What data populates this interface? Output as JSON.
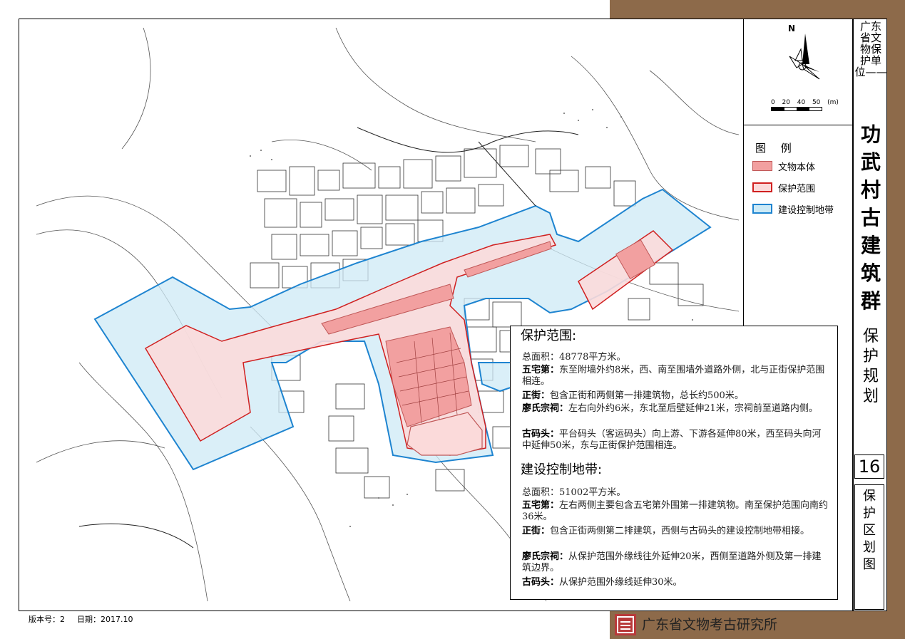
{
  "title": {
    "subtitle_chars": [
      "广东",
      "省文",
      "物保",
      "护单",
      "位——"
    ],
    "main_chars": [
      "功",
      "武",
      "村",
      "古",
      "建",
      "筑",
      "群"
    ],
    "plan_chars": [
      "保",
      "护",
      "规",
      "划"
    ]
  },
  "sheet": {
    "number": "16",
    "name_chars": [
      "保",
      "护",
      "区",
      "划",
      "图"
    ]
  },
  "compass": {
    "north_label": "N",
    "scale_labels": [
      "0",
      "20",
      "40",
      "50",
      "(m)"
    ]
  },
  "legend": {
    "title": "图 例",
    "items": [
      {
        "label": "文物本体",
        "fill": "#f2a0a0",
        "stroke": "#c05858"
      },
      {
        "label": "保护范围",
        "fill": "#fbdada",
        "stroke": "#d02020"
      },
      {
        "label": "建设控制地带",
        "fill": "#cdeaf6",
        "stroke": "#1e84d0"
      }
    ]
  },
  "protection": {
    "heading": "保护范围:",
    "total_area": "总面积：48778平方米。",
    "items": [
      {
        "name": "五宅第：",
        "text": "东至附墙外约8米，西、南至围墙外道路外侧，北与正街保护范围相连。"
      },
      {
        "name": "正街：",
        "text": "包含正街和两侧第一排建筑物，总长约500米。"
      },
      {
        "name": "廖氏宗祠：",
        "text": "左右向外约6米，东北至后壁延伸21米，宗祠前至道路内侧。"
      },
      {
        "name": "古码头：",
        "text": "平台码头（客运码头）向上游、下游各延伸80米，西至码头向河中延伸50米，东与正街保护范围相连。"
      }
    ]
  },
  "control": {
    "heading": "建设控制地带:",
    "total_area": "总面积：51002平方米。",
    "items": [
      {
        "name": "五宅第：",
        "text": "左右两侧主要包含五宅第外围第一排建筑物。南至保护范围向南约36米。"
      },
      {
        "name": "正街：",
        "text": "包含正街两侧第二排建筑，西侧与古码头的建设控制地带相接。"
      },
      {
        "name": "廖氏宗祠：",
        "text": "从保护范围外缘线往外延伸20米，西侧至道路外侧及第一排建筑边界。"
      },
      {
        "name": "古码头：",
        "text": "从保护范围外缘线延伸30米。"
      }
    ]
  },
  "footer": {
    "version": "版本号：2",
    "date": "日期：2017.10",
    "institute": "广东省文物考古研究所"
  }
}
